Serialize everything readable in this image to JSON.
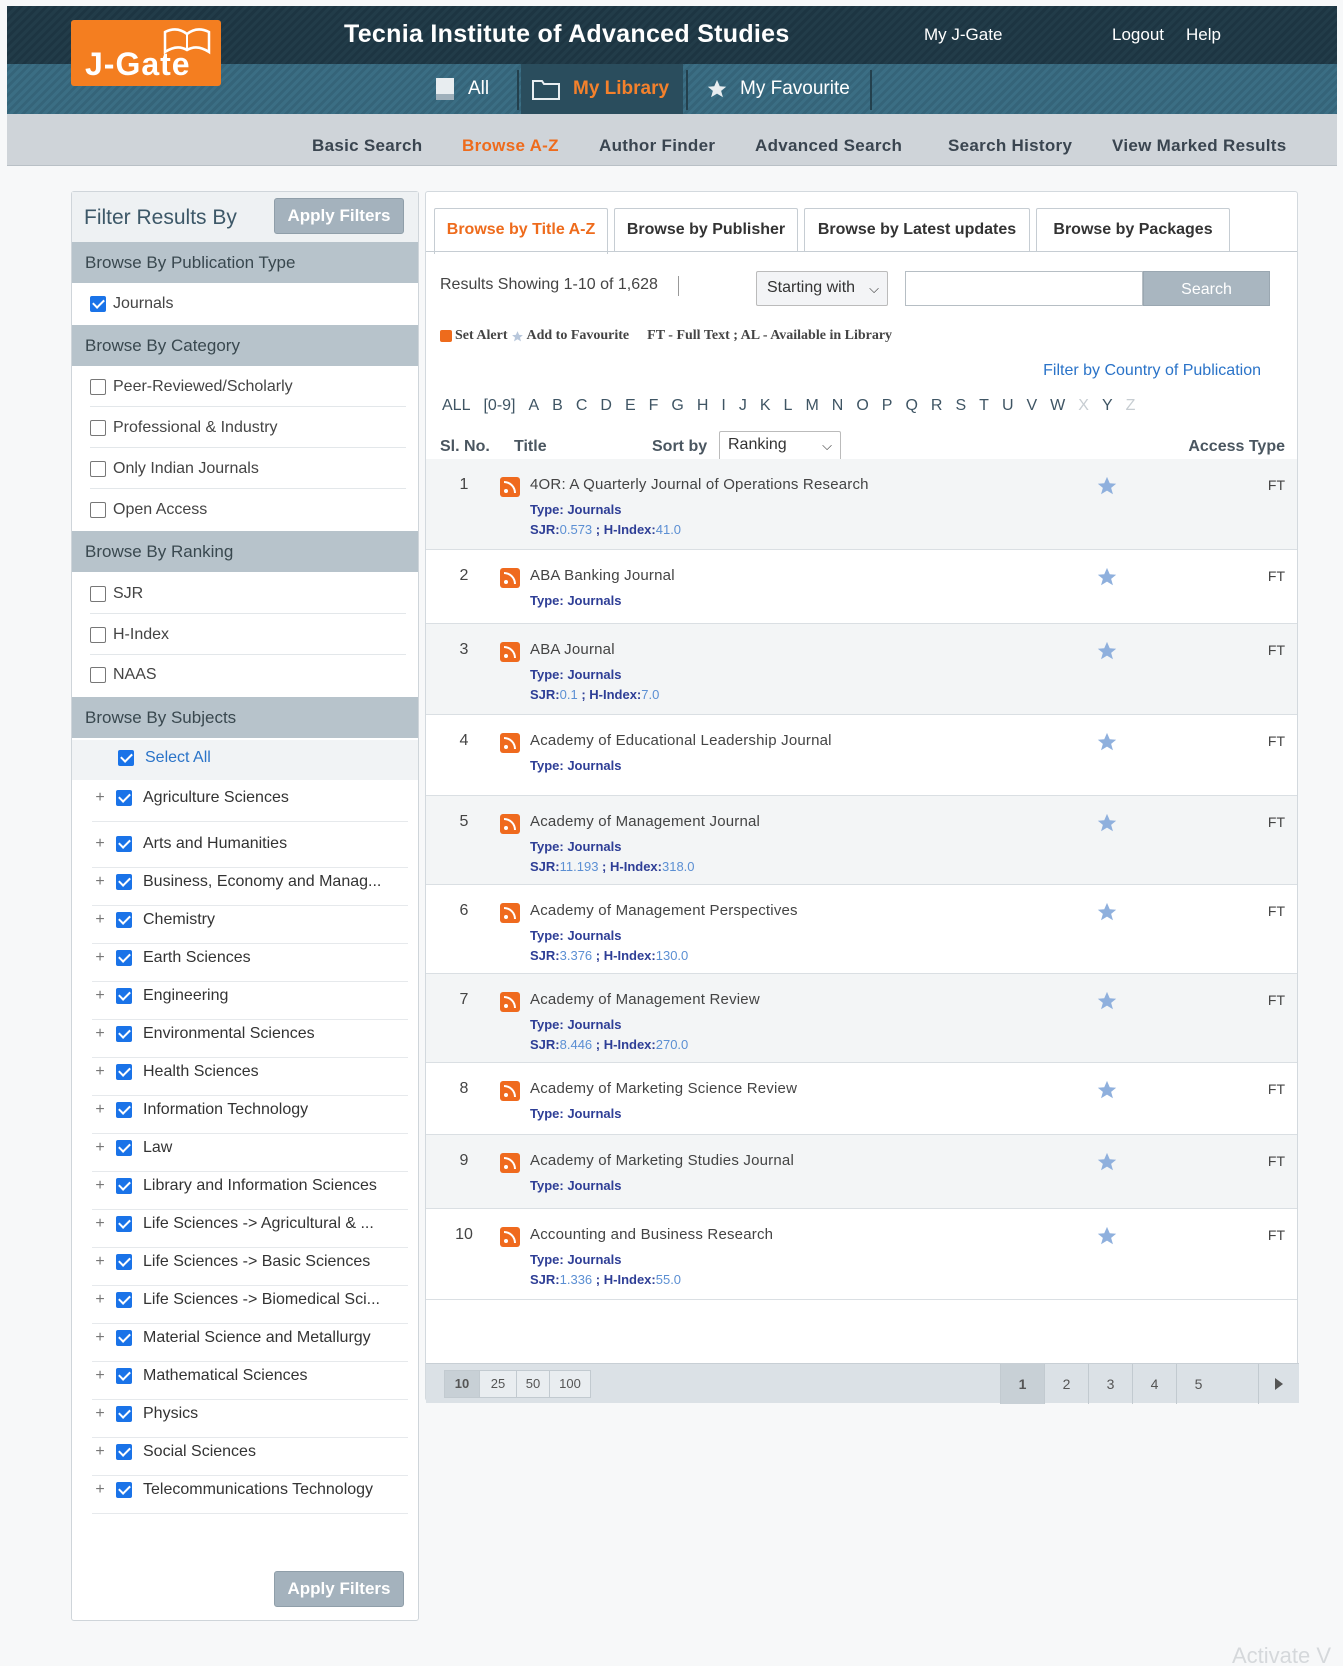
{
  "header": {
    "logo_text": "J-Gate",
    "institute": "Tecnia Institute of Advanced Studies",
    "links": [
      "My J-Gate",
      "Logout",
      "Help"
    ],
    "tabs": [
      {
        "label": "All",
        "icon": "document-icon"
      },
      {
        "label": "My Library",
        "icon": "folder-icon",
        "active": true
      },
      {
        "label": "My Favourite",
        "icon": "star-icon"
      }
    ]
  },
  "subnav": [
    "Basic Search",
    "Browse A-Z",
    "Author Finder",
    "Advanced Search",
    "Search History",
    "View Marked Results"
  ],
  "subnav_active": "Browse A-Z",
  "sidebar": {
    "title": "Filter Results By",
    "apply": "Apply Filters",
    "pub_type": {
      "heading": "Browse By Publication Type",
      "options": [
        {
          "label": "Journals",
          "checked": true
        }
      ]
    },
    "category": {
      "heading": "Browse By Category",
      "options": [
        {
          "label": "Peer-Reviewed/Scholarly",
          "checked": false
        },
        {
          "label": "Professional & Industry",
          "checked": false
        },
        {
          "label": "Only Indian Journals",
          "checked": false
        },
        {
          "label": "Open Access",
          "checked": false
        }
      ]
    },
    "ranking": {
      "heading": "Browse By Ranking",
      "options": [
        {
          "label": "SJR",
          "checked": false
        },
        {
          "label": "H-Index",
          "checked": false
        },
        {
          "label": "NAAS",
          "checked": false
        }
      ]
    },
    "subjects": {
      "heading": "Browse By Subjects",
      "select_all": "Select All",
      "items": [
        "Agriculture Sciences",
        "Arts and Humanities",
        "Business, Economy and Manag...",
        "Chemistry",
        "Earth Sciences",
        "Engineering",
        "Environmental Sciences",
        "Health Sciences",
        "Information Technology",
        "Law",
        "Library and Information Sciences",
        "Life Sciences -> Agricultural & ...",
        "Life Sciences -> Basic Sciences",
        "Life Sciences -> Biomedical Sci...",
        "Material Science and Metallurgy",
        "Mathematical Sciences",
        "Physics",
        "Social Sciences",
        "Telecommunications Technology"
      ]
    }
  },
  "main": {
    "tabs": [
      "Browse by Title A-Z",
      "Browse by Publisher",
      "Browse by Latest updates",
      "Browse by Packages"
    ],
    "results": "Results Showing 1-10 of 1,628",
    "match_select": "Starting with",
    "search_placeholder": "",
    "search_btn": "Search",
    "set_alert": "Set Alert",
    "add_fav": "Add to Favourite",
    "legend": "FT - Full Text ; AL - Available in Library",
    "country_link": "Filter by Country of Publication",
    "alphabet": [
      "ALL",
      "[0-9]",
      "A",
      "B",
      "C",
      "D",
      "E",
      "F",
      "G",
      "H",
      "I",
      "J",
      "K",
      "L",
      "M",
      "N",
      "O",
      "P",
      "Q",
      "R",
      "S",
      "T",
      "U",
      "V",
      "W",
      "X",
      "Y",
      "Z"
    ],
    "alphabet_disabled": [
      "X",
      "Z"
    ],
    "columns": {
      "sl": "Sl. No.",
      "title": "Title",
      "sortby": "Sort by",
      "sort_value": "Ranking",
      "access": "Access Type"
    },
    "rows": [
      {
        "num": "1",
        "title": "4OR: A Quarterly Journal of Operations Research",
        "type": "Type: Journals",
        "sjr": "0.573",
        "hindex": "41.0",
        "access": "FT"
      },
      {
        "num": "2",
        "title": "ABA Banking Journal",
        "type": "Type: Journals",
        "sjr": "",
        "hindex": "",
        "access": "FT"
      },
      {
        "num": "3",
        "title": "ABA Journal",
        "type": "Type: Journals",
        "sjr": "0.1",
        "hindex": "7.0",
        "access": "FT"
      },
      {
        "num": "4",
        "title": "Academy of Educational Leadership Journal",
        "type": "Type: Journals",
        "sjr": "",
        "hindex": "",
        "access": "FT"
      },
      {
        "num": "5",
        "title": "Academy of Management Journal",
        "type": "Type: Journals",
        "sjr": "11.193",
        "hindex": "318.0",
        "access": "FT"
      },
      {
        "num": "6",
        "title": "Academy of Management Perspectives",
        "type": "Type: Journals",
        "sjr": "3.376",
        "hindex": "130.0",
        "access": "FT"
      },
      {
        "num": "7",
        "title": "Academy of Management Review",
        "type": "Type: Journals",
        "sjr": "8.446",
        "hindex": "270.0",
        "access": "FT"
      },
      {
        "num": "8",
        "title": "Academy of Marketing Science Review",
        "type": "Type: Journals",
        "sjr": "",
        "hindex": "",
        "access": "FT"
      },
      {
        "num": "9",
        "title": "Academy of Marketing Studies Journal",
        "type": "Type: Journals",
        "sjr": "",
        "hindex": "",
        "access": "FT"
      },
      {
        "num": "10",
        "title": "Accounting and Business Research",
        "type": "Type: Journals",
        "sjr": "1.336",
        "hindex": "55.0",
        "access": "FT"
      }
    ],
    "sjr_label": "SJR:",
    "hindex_label": "H-Index:",
    "page_sizes": [
      "10",
      "25",
      "50",
      "100"
    ],
    "page_size_active": "10",
    "pages": [
      "1",
      "2",
      "3",
      "4",
      "5"
    ],
    "page_active": "1"
  },
  "watermark": "Activate V",
  "colors": {
    "accent": "#ee6b1c",
    "header_dark": "#223c49",
    "nav": "#3b6e84",
    "link": "#2a73c8",
    "check": "#1a73e8"
  }
}
